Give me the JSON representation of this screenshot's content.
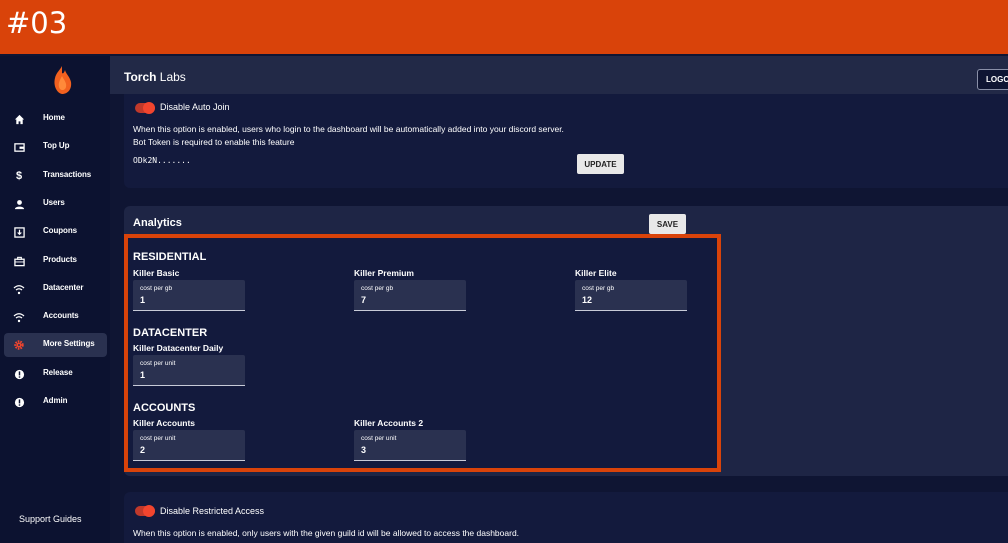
{
  "overlay_label": "#03",
  "colors": {
    "accent": "#d9430a",
    "toggle": "#f2452e",
    "bg": "#0f1533",
    "panel": "#131a3d"
  },
  "sidebar": {
    "logo_icon": "flame-icon",
    "items": [
      {
        "label": "Home",
        "icon": "home-icon"
      },
      {
        "label": "Top Up",
        "icon": "wallet-icon"
      },
      {
        "label": "Transactions",
        "icon": "dollar-icon"
      },
      {
        "label": "Users",
        "icon": "user-icon"
      },
      {
        "label": "Coupons",
        "icon": "coupon-icon"
      },
      {
        "label": "Products",
        "icon": "briefcase-icon"
      },
      {
        "label": "Datacenter",
        "icon": "wifi-icon"
      },
      {
        "label": "Accounts",
        "icon": "wifi-icon"
      },
      {
        "label": "More Settings",
        "icon": "gear-icon",
        "active": true
      },
      {
        "label": "Release",
        "icon": "alert-icon"
      },
      {
        "label": "Admin",
        "icon": "alert-icon"
      }
    ],
    "support_label": "Support Guides"
  },
  "header": {
    "title_bold": "Torch",
    "title_rest": " Labs",
    "logout_label": "LOGOUT"
  },
  "auto_join": {
    "toggle_label": "Disable Auto Join",
    "desc_line1": "When this option is enabled, users who login to the dashboard will be automatically added into your discord server.",
    "desc_line2": "Bot Token is required to enable this feature",
    "token_value": "ODk2N.......",
    "update_label": "UPDATE"
  },
  "analytics": {
    "title": "Analytics",
    "save_label": "SAVE",
    "residential": {
      "title": "RESIDENTIAL",
      "products": [
        {
          "name": "Killer Basic",
          "field_label": "cost per gb",
          "value": "1"
        },
        {
          "name": "Killer Premium",
          "field_label": "cost per gb",
          "value": "7"
        },
        {
          "name": "Killer Elite",
          "field_label": "cost per gb",
          "value": "12"
        }
      ]
    },
    "datacenter": {
      "title": "DATACENTER",
      "products": [
        {
          "name": "Killer Datacenter Daily",
          "field_label": "cost per unit",
          "value": "1"
        }
      ]
    },
    "accounts": {
      "title": "ACCOUNTS",
      "products": [
        {
          "name": "Killer Accounts",
          "field_label": "cost per unit",
          "value": "2"
        },
        {
          "name": "Killer Accounts 2",
          "field_label": "cost per unit",
          "value": "3"
        }
      ]
    }
  },
  "restricted": {
    "toggle_label": "Disable Restricted Access",
    "desc": "When this option is enabled, only users with the given guild id will be allowed to access the dashboard."
  }
}
